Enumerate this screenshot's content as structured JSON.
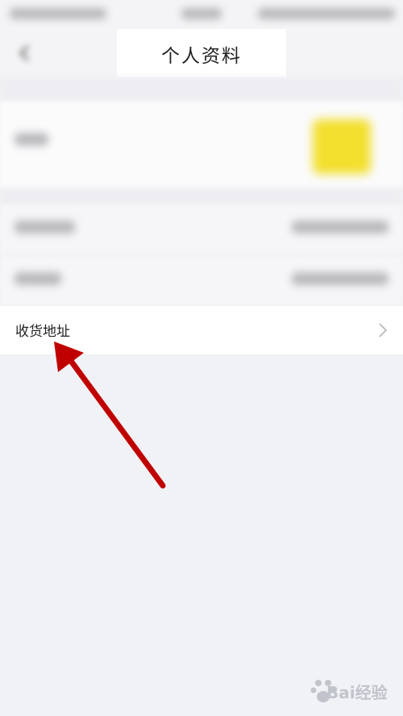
{
  "header": {
    "title": "个人资料"
  },
  "rows": {
    "address_label": "收货地址"
  },
  "icons": {
    "back": "back-arrow-icon",
    "chevron": "chevron-right-icon",
    "annotation": "red-arrow-annotation-icon"
  },
  "colors": {
    "background": "#f1f2f6",
    "card": "#ffffff",
    "avatar": "#f2df2e",
    "annotation_arrow": "#c00000",
    "title_text": "#222222",
    "chevron": "#b5b5b5"
  },
  "watermark": {
    "text": "Bai经验"
  }
}
